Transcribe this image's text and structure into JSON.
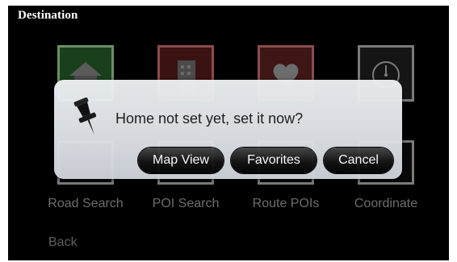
{
  "screen": {
    "title": "Destination",
    "back_label": "Back"
  },
  "tiles": [
    {
      "label": "Road Search"
    },
    {
      "label": "POI Search"
    },
    {
      "label": "Route POIs"
    },
    {
      "label": "Coordinate"
    }
  ],
  "dialog": {
    "message": "Home not set yet, set it now?",
    "buttons": {
      "map_view": "Map View",
      "favorites": "Favorites",
      "cancel": "Cancel"
    }
  },
  "icons": {
    "pin": "pushpin-icon",
    "home": "house-icon",
    "poi": "building-icon",
    "route": "heart-icon",
    "coordinate": "compass-icon"
  }
}
